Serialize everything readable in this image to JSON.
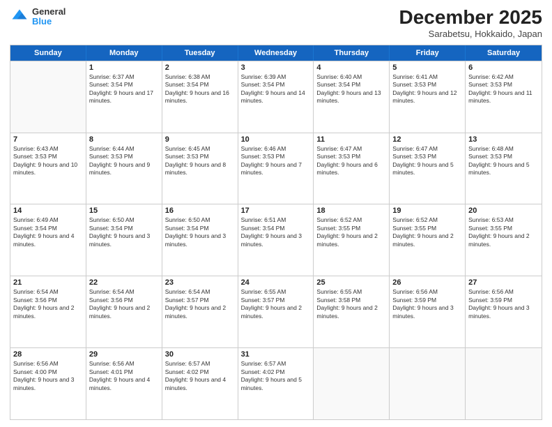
{
  "header": {
    "logo": {
      "general": "General",
      "blue": "Blue"
    },
    "title": "December 2025",
    "subtitle": "Sarabetsu, Hokkaido, Japan"
  },
  "calendar": {
    "days_of_week": [
      "Sunday",
      "Monday",
      "Tuesday",
      "Wednesday",
      "Thursday",
      "Friday",
      "Saturday"
    ],
    "rows": [
      [
        {
          "day": "",
          "empty": true
        },
        {
          "day": "1",
          "sunrise": "Sunrise: 6:37 AM",
          "sunset": "Sunset: 3:54 PM",
          "daylight": "Daylight: 9 hours and 17 minutes."
        },
        {
          "day": "2",
          "sunrise": "Sunrise: 6:38 AM",
          "sunset": "Sunset: 3:54 PM",
          "daylight": "Daylight: 9 hours and 16 minutes."
        },
        {
          "day": "3",
          "sunrise": "Sunrise: 6:39 AM",
          "sunset": "Sunset: 3:54 PM",
          "daylight": "Daylight: 9 hours and 14 minutes."
        },
        {
          "day": "4",
          "sunrise": "Sunrise: 6:40 AM",
          "sunset": "Sunset: 3:54 PM",
          "daylight": "Daylight: 9 hours and 13 minutes."
        },
        {
          "day": "5",
          "sunrise": "Sunrise: 6:41 AM",
          "sunset": "Sunset: 3:53 PM",
          "daylight": "Daylight: 9 hours and 12 minutes."
        },
        {
          "day": "6",
          "sunrise": "Sunrise: 6:42 AM",
          "sunset": "Sunset: 3:53 PM",
          "daylight": "Daylight: 9 hours and 11 minutes."
        }
      ],
      [
        {
          "day": "7",
          "sunrise": "Sunrise: 6:43 AM",
          "sunset": "Sunset: 3:53 PM",
          "daylight": "Daylight: 9 hours and 10 minutes."
        },
        {
          "day": "8",
          "sunrise": "Sunrise: 6:44 AM",
          "sunset": "Sunset: 3:53 PM",
          "daylight": "Daylight: 9 hours and 9 minutes."
        },
        {
          "day": "9",
          "sunrise": "Sunrise: 6:45 AM",
          "sunset": "Sunset: 3:53 PM",
          "daylight": "Daylight: 9 hours and 8 minutes."
        },
        {
          "day": "10",
          "sunrise": "Sunrise: 6:46 AM",
          "sunset": "Sunset: 3:53 PM",
          "daylight": "Daylight: 9 hours and 7 minutes."
        },
        {
          "day": "11",
          "sunrise": "Sunrise: 6:47 AM",
          "sunset": "Sunset: 3:53 PM",
          "daylight": "Daylight: 9 hours and 6 minutes."
        },
        {
          "day": "12",
          "sunrise": "Sunrise: 6:47 AM",
          "sunset": "Sunset: 3:53 PM",
          "daylight": "Daylight: 9 hours and 5 minutes."
        },
        {
          "day": "13",
          "sunrise": "Sunrise: 6:48 AM",
          "sunset": "Sunset: 3:53 PM",
          "daylight": "Daylight: 9 hours and 5 minutes."
        }
      ],
      [
        {
          "day": "14",
          "sunrise": "Sunrise: 6:49 AM",
          "sunset": "Sunset: 3:54 PM",
          "daylight": "Daylight: 9 hours and 4 minutes."
        },
        {
          "day": "15",
          "sunrise": "Sunrise: 6:50 AM",
          "sunset": "Sunset: 3:54 PM",
          "daylight": "Daylight: 9 hours and 3 minutes."
        },
        {
          "day": "16",
          "sunrise": "Sunrise: 6:50 AM",
          "sunset": "Sunset: 3:54 PM",
          "daylight": "Daylight: 9 hours and 3 minutes."
        },
        {
          "day": "17",
          "sunrise": "Sunrise: 6:51 AM",
          "sunset": "Sunset: 3:54 PM",
          "daylight": "Daylight: 9 hours and 3 minutes."
        },
        {
          "day": "18",
          "sunrise": "Sunrise: 6:52 AM",
          "sunset": "Sunset: 3:55 PM",
          "daylight": "Daylight: 9 hours and 2 minutes."
        },
        {
          "day": "19",
          "sunrise": "Sunrise: 6:52 AM",
          "sunset": "Sunset: 3:55 PM",
          "daylight": "Daylight: 9 hours and 2 minutes."
        },
        {
          "day": "20",
          "sunrise": "Sunrise: 6:53 AM",
          "sunset": "Sunset: 3:55 PM",
          "daylight": "Daylight: 9 hours and 2 minutes."
        }
      ],
      [
        {
          "day": "21",
          "sunrise": "Sunrise: 6:54 AM",
          "sunset": "Sunset: 3:56 PM",
          "daylight": "Daylight: 9 hours and 2 minutes."
        },
        {
          "day": "22",
          "sunrise": "Sunrise: 6:54 AM",
          "sunset": "Sunset: 3:56 PM",
          "daylight": "Daylight: 9 hours and 2 minutes."
        },
        {
          "day": "23",
          "sunrise": "Sunrise: 6:54 AM",
          "sunset": "Sunset: 3:57 PM",
          "daylight": "Daylight: 9 hours and 2 minutes."
        },
        {
          "day": "24",
          "sunrise": "Sunrise: 6:55 AM",
          "sunset": "Sunset: 3:57 PM",
          "daylight": "Daylight: 9 hours and 2 minutes."
        },
        {
          "day": "25",
          "sunrise": "Sunrise: 6:55 AM",
          "sunset": "Sunset: 3:58 PM",
          "daylight": "Daylight: 9 hours and 2 minutes."
        },
        {
          "day": "26",
          "sunrise": "Sunrise: 6:56 AM",
          "sunset": "Sunset: 3:59 PM",
          "daylight": "Daylight: 9 hours and 3 minutes."
        },
        {
          "day": "27",
          "sunrise": "Sunrise: 6:56 AM",
          "sunset": "Sunset: 3:59 PM",
          "daylight": "Daylight: 9 hours and 3 minutes."
        }
      ],
      [
        {
          "day": "28",
          "sunrise": "Sunrise: 6:56 AM",
          "sunset": "Sunset: 4:00 PM",
          "daylight": "Daylight: 9 hours and 3 minutes."
        },
        {
          "day": "29",
          "sunrise": "Sunrise: 6:56 AM",
          "sunset": "Sunset: 4:01 PM",
          "daylight": "Daylight: 9 hours and 4 minutes."
        },
        {
          "day": "30",
          "sunrise": "Sunrise: 6:57 AM",
          "sunset": "Sunset: 4:02 PM",
          "daylight": "Daylight: 9 hours and 4 minutes."
        },
        {
          "day": "31",
          "sunrise": "Sunrise: 6:57 AM",
          "sunset": "Sunset: 4:02 PM",
          "daylight": "Daylight: 9 hours and 5 minutes."
        },
        {
          "day": "",
          "empty": true
        },
        {
          "day": "",
          "empty": true
        },
        {
          "day": "",
          "empty": true
        }
      ]
    ]
  }
}
